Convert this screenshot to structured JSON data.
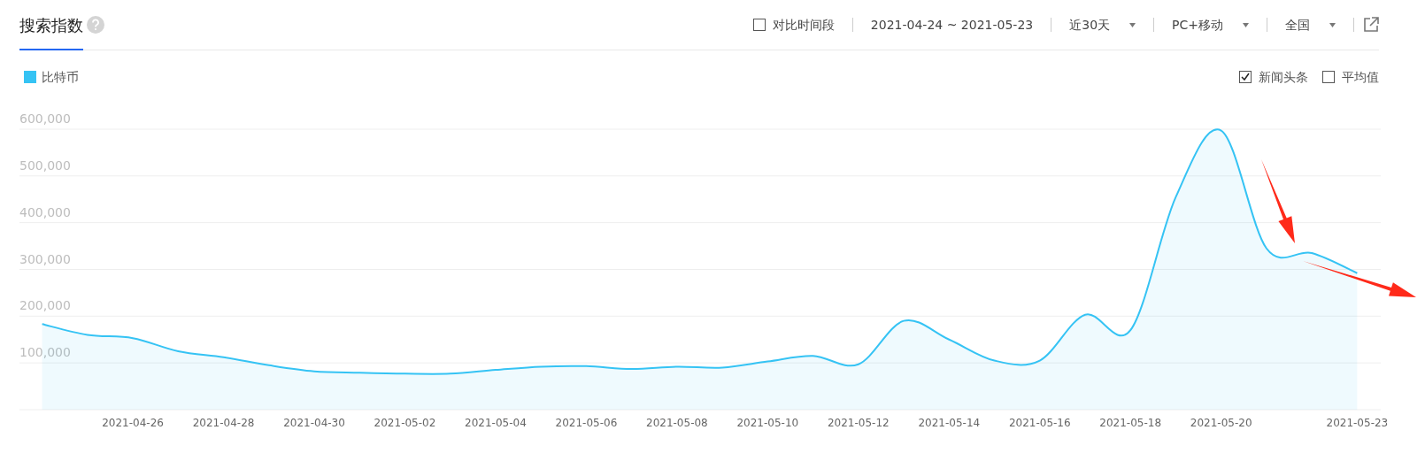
{
  "header": {
    "title": "搜索指数",
    "compare": {
      "label": "对比时间段",
      "checked": false
    },
    "date_range": "2021-04-24 ~ 2021-05-23",
    "dropdowns": [
      {
        "label": "近30天"
      },
      {
        "label": "PC+移动"
      },
      {
        "label": "全国"
      }
    ]
  },
  "options": [
    {
      "label": "新闻头条",
      "checked": true
    },
    {
      "label": "平均值",
      "checked": false
    }
  ],
  "chart_data": {
    "type": "area",
    "categories": [
      null,
      null,
      "2021-04-26",
      null,
      "2021-04-28",
      null,
      "2021-04-30",
      null,
      "2021-05-02",
      null,
      "2021-05-04",
      null,
      "2021-05-06",
      null,
      "2021-05-08",
      null,
      "2021-05-10",
      null,
      "2021-05-12",
      null,
      "2021-05-14",
      null,
      "2021-05-16",
      null,
      "2021-05-18",
      null,
      "2021-05-20",
      null,
      null,
      "2021-05-23"
    ],
    "grid": true,
    "series": [
      {
        "name": "比特币",
        "color": "#35c3f4",
        "values": [
          183000,
          160000,
          153000,
          125000,
          112000,
          95000,
          82000,
          79000,
          77000,
          77000,
          85000,
          92000,
          93000,
          87000,
          92000,
          90000,
          103000,
          115000,
          97000,
          190000,
          150000,
          105000,
          105000,
          203000,
          170000,
          455000,
          597000,
          345000,
          335000,
          292000
        ]
      }
    ],
    "ylim": [
      0,
      600000
    ],
    "yticks": [
      {
        "value": 100000,
        "label": "100,000"
      },
      {
        "value": 200000,
        "label": "200,000"
      },
      {
        "value": 300000,
        "label": "300,000"
      },
      {
        "value": 400000,
        "label": "400,000"
      },
      {
        "value": 500000,
        "label": "500,000"
      },
      {
        "value": 600000,
        "label": "600,000"
      }
    ]
  }
}
